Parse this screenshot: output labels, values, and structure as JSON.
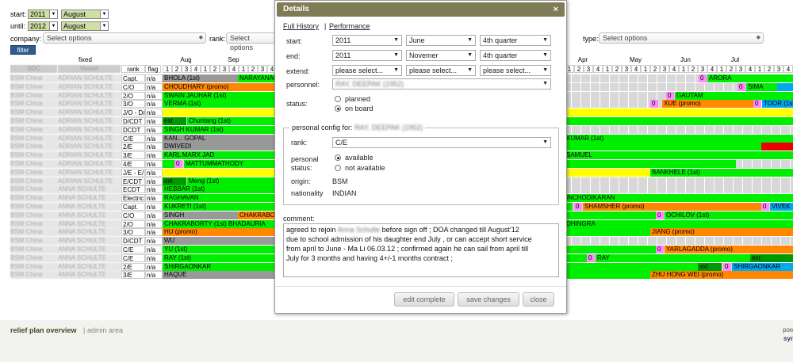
{
  "toolbar": {
    "start_label": "start:",
    "start_year": "2011",
    "start_month": "August",
    "until_label": "until:",
    "until_year": "2012",
    "until_month": "August",
    "company_label": "company:",
    "company_ph": "Select options",
    "rank_label": "rank:",
    "rank_ph": "Select options",
    "type_label": "type:",
    "type_ph": "Select options",
    "filter_label": "filter"
  },
  "grid": {
    "fixed_label": "fixed",
    "rank_header": "rank",
    "flag_header": "flag",
    "col_hdr1": "SDC",
    "col_hdr2": "Vessel",
    "months": [
      "Aug",
      "Sep",
      "Apr",
      "May",
      "Jun",
      "Jul"
    ],
    "weeks": [
      "1",
      "2",
      "3",
      "4"
    ],
    "rows": [
      {
        "c1": "BSM China",
        "c2": "ADRIAN SCHULTE",
        "rank": "Capt.",
        "flag": "n/a",
        "bars": [
          {
            "l": 205,
            "w": 120,
            "t": "BHOLA (1st)",
            "c": "#999"
          },
          {
            "l": 300,
            "w": 46,
            "t": "NARAYANAN",
            "c": "#00ee00"
          },
          {
            "l": 881,
            "w": 10,
            "t": "0",
            "c": "#ff88ff"
          },
          {
            "l": 892,
            "w": 108,
            "t": "ARORA",
            "c": "#00ee00"
          }
        ]
      },
      {
        "c1": "BSM China",
        "c2": "ADRIAN SCHULTE",
        "rank": "C/O",
        "flag": "n/a",
        "bars": [
          {
            "l": 205,
            "w": 141,
            "t": "CHOUDHARY (promo)",
            "c": "#ff8800"
          },
          {
            "l": 930,
            "w": 10,
            "t": "0",
            "c": "#ff88ff"
          },
          {
            "l": 941,
            "w": 40,
            "t": "SIMA",
            "c": "#00ee00"
          },
          {
            "l": 980,
            "w": 20,
            "t": "",
            "c": "#00aaee"
          }
        ]
      },
      {
        "c1": "BSM China",
        "c2": "ADRIAN SCHULTE",
        "rank": "2/O",
        "flag": "n/a",
        "bars": [
          {
            "l": 205,
            "w": 141,
            "t": "SWAIN       JAUHAR (1st)",
            "c": "#00ee00"
          },
          {
            "l": 840,
            "w": 10,
            "t": "0",
            "c": "#ff88ff"
          },
          {
            "l": 851,
            "w": 149,
            "t": "GAUTAM",
            "c": "#00ee00"
          }
        ]
      },
      {
        "c1": "BSM China",
        "c2": "ADRIAN SCHULTE",
        "rank": "3/O",
        "flag": "n/a",
        "bars": [
          {
            "l": 205,
            "w": 141,
            "t": "VERMA (1st)",
            "c": "#00ee00"
          },
          {
            "l": 820,
            "w": 10,
            "t": "0",
            "c": "#ff88ff"
          },
          {
            "l": 835,
            "w": 120,
            "t": "XUE (promo)",
            "c": "#ff8800"
          },
          {
            "l": 950,
            "w": 10,
            "t": "0",
            "c": "#ff88ff"
          },
          {
            "l": 961,
            "w": 39,
            "t": "TOOR (1st)",
            "c": "#00aaee"
          }
        ]
      },
      {
        "c1": "BSM China",
        "c2": "ADRIAN SCHULTE",
        "rank": "J/O - D/",
        "flag": "n/a",
        "bars": [
          {
            "l": 205,
            "w": 141,
            "t": "",
            "c": "#ffff00"
          },
          {
            "l": 712,
            "w": 288,
            "t": "",
            "c": "#ffff00"
          }
        ]
      },
      {
        "c1": "BSM China",
        "c2": "ADRIAN SCHULTE",
        "rank": "D/CDT",
        "flag": "n/a",
        "bars": [
          {
            "l": 205,
            "w": 30,
            "t": "ext",
            "c": "#009900"
          },
          {
            "l": 236,
            "w": 110,
            "t": "Chuntang (1st)",
            "c": "#00ee00"
          },
          {
            "l": 712,
            "w": 288,
            "t": "",
            "c": "#00ee00"
          }
        ]
      },
      {
        "c1": "BSM China",
        "c2": "ADRIAN SCHULTE",
        "rank": "DCDT",
        "flag": "n/a",
        "bars": [
          {
            "l": 205,
            "w": 141,
            "t": "SINGH KUMAR (1st)",
            "c": "#00ee00"
          }
        ]
      },
      {
        "c1": "BSM China",
        "c2": "ADRIAN SCHULTE",
        "rank": "C/E",
        "flag": "n/a",
        "bars": [
          {
            "l": 205,
            "w": 141,
            "t": "KAN...       GOPAL",
            "c": "#999"
          },
          {
            "l": 712,
            "w": 288,
            "t": "                        KUMAR (1st)",
            "c": "#00ee00"
          }
        ]
      },
      {
        "c1": "BSM China",
        "c2": "ADRIAN SCHULTE",
        "rank": "2/E",
        "flag": "n/a",
        "bars": [
          {
            "l": 205,
            "w": 141,
            "t": "DWIVEDI",
            "c": "#999"
          },
          {
            "l": 712,
            "w": 248,
            "t": "",
            "c": "#00ee00"
          },
          {
            "l": 960,
            "w": 40,
            "t": "",
            "c": "#ee0000"
          }
        ]
      },
      {
        "c1": "BSM China",
        "c2": "ADRIAN SCHULTE",
        "rank": "3/E",
        "flag": "n/a",
        "bars": [
          {
            "l": 205,
            "w": 141,
            "t": "KARL MARX                              JAD",
            "c": "#00ee00"
          },
          {
            "l": 712,
            "w": 288,
            "t": "         SAMUEL",
            "c": "#00ee00"
          }
        ]
      },
      {
        "c1": "BSM China",
        "c2": "ADRIAN SCHULTE",
        "rank": "4/E",
        "flag": "n/a",
        "bars": [
          {
            "l": 205,
            "w": 15,
            "t": "",
            "c": "#00ee00"
          },
          {
            "l": 220,
            "w": 10,
            "t": "0",
            "c": "#ff88ff"
          },
          {
            "l": 232,
            "w": 114,
            "t": "MATTUMMATHODY",
            "c": "#00ee00"
          },
          {
            "l": 712,
            "w": 216,
            "t": "",
            "c": "#00ee00"
          }
        ]
      },
      {
        "c1": "BSM China",
        "c2": "ADRIAN SCHULTE",
        "rank": "J/E - E/",
        "flag": "n/a",
        "bars": [
          {
            "l": 205,
            "w": 141,
            "t": "",
            "c": "#ffff00"
          },
          {
            "l": 712,
            "w": 108,
            "t": "",
            "c": "#ffff00"
          },
          {
            "l": 820,
            "w": 180,
            "t": "BANKHELE (1st)",
            "c": "#00ee00"
          }
        ]
      },
      {
        "c1": "BSM China",
        "c2": "ADRIAN SCHULTE",
        "rank": "E/CDT",
        "flag": "n/a",
        "bars": [
          {
            "l": 205,
            "w": 30,
            "t": "ext",
            "c": "#009900"
          },
          {
            "l": 236,
            "w": 110,
            "t": "Meng (1st)",
            "c": "#00ee00"
          }
        ]
      },
      {
        "c1": "BSM China",
        "c2": "ANNA SCHULTE",
        "rank": "ECDT",
        "flag": "n/a",
        "bars": [
          {
            "l": 205,
            "w": 141,
            "t": "HEBBAR (1st)",
            "c": "#00ee00"
          }
        ]
      },
      {
        "c1": "BSM China",
        "c2": "ANNA SCHULTE",
        "rank": "Electric",
        "flag": "n/a",
        "bars": [
          {
            "l": 205,
            "w": 141,
            "t": "RAGHAVAN",
            "c": "#00ee00"
          },
          {
            "l": 712,
            "w": 288,
            "t": "            INCHODIKARAN",
            "c": "#00ee00"
          }
        ]
      },
      {
        "c1": "BSM China",
        "c2": "ANNA SCHULTE",
        "rank": "Capt.",
        "flag": "n/a",
        "bars": [
          {
            "l": 205,
            "w": 141,
            "t": "KUKRETI (1st)",
            "c": "#00ee00"
          },
          {
            "l": 712,
            "w": 10,
            "t": "",
            "c": "#00ee00"
          },
          {
            "l": 724,
            "w": 10,
            "t": "0",
            "c": "#ff88ff"
          },
          {
            "l": 735,
            "w": 225,
            "t": "SHAMSHER (promo)",
            "c": "#ff8800"
          },
          {
            "l": 960,
            "w": 10,
            "t": "0",
            "c": "#ff88ff"
          },
          {
            "l": 971,
            "w": 29,
            "t": "VIVEK",
            "c": "#00aaee"
          }
        ]
      },
      {
        "c1": "BSM China",
        "c2": "ANNA SCHULTE",
        "rank": "C/O",
        "flag": "n/a",
        "bars": [
          {
            "l": 205,
            "w": 95,
            "t": "SINGH",
            "c": "#999"
          },
          {
            "l": 300,
            "w": 46,
            "t": "CHAKRABO",
            "c": "#ff8800"
          },
          {
            "l": 712,
            "w": 115,
            "t": "",
            "c": "#00ee00"
          },
          {
            "l": 827,
            "w": 10,
            "t": "0",
            "c": "#ff88ff"
          },
          {
            "l": 838,
            "w": 162,
            "t": "OCHILOV (1st)",
            "c": "#00ee00"
          }
        ]
      },
      {
        "c1": "BSM China",
        "c2": "ANNA SCHULTE",
        "rank": "2/O",
        "flag": "n/a",
        "bars": [
          {
            "l": 205,
            "w": 141,
            "t": "CHAKRABORTY (1st)     BHADAURIA",
            "c": "#00ee00"
          },
          {
            "l": 712,
            "w": 288,
            "t": "DHINGRA",
            "c": "#00ee00"
          }
        ]
      },
      {
        "c1": "BSM China",
        "c2": "ANNA SCHULTE",
        "rank": "3/O",
        "flag": "n/a",
        "bars": [
          {
            "l": 205,
            "w": 141,
            "t": "HU (promo)",
            "c": "#ff8800"
          },
          {
            "l": 712,
            "w": 108,
            "t": "",
            "c": "#00ee00"
          },
          {
            "l": 820,
            "w": 180,
            "t": "JIANG (promo)",
            "c": "#ff8800"
          }
        ]
      },
      {
        "c1": "BSM China",
        "c2": "ANNA SCHULTE",
        "rank": "D/CDT",
        "flag": "n/a",
        "bars": [
          {
            "l": 205,
            "w": 141,
            "t": "WU",
            "c": "#999"
          }
        ]
      },
      {
        "c1": "BSM China",
        "c2": "ANNA SCHULTE",
        "rank": "C/E",
        "flag": "n/a",
        "bars": [
          {
            "l": 205,
            "w": 141,
            "t": "YU (1st)",
            "c": "#00ee00"
          },
          {
            "l": 712,
            "w": 115,
            "t": "",
            "c": "#00ee00"
          },
          {
            "l": 827,
            "w": 10,
            "t": "0",
            "c": "#ff88ff"
          },
          {
            "l": 838,
            "w": 162,
            "t": "YARLAGADDA (promo)",
            "c": "#ff8800"
          }
        ]
      },
      {
        "c1": "BSM China",
        "c2": "ANNA SCHULTE",
        "rank": "C/E",
        "flag": "n/a",
        "bars": [
          {
            "l": 205,
            "w": 141,
            "t": "RAY (1st)",
            "c": "#00ee00"
          },
          {
            "l": 712,
            "w": 28,
            "t": "",
            "c": "#00ee00"
          },
          {
            "l": 740,
            "w": 10,
            "t": "0",
            "c": "#ff88ff"
          },
          {
            "l": 751,
            "w": 195,
            "t": "RAY",
            "c": "#00ee00"
          },
          {
            "l": 946,
            "w": 54,
            "t": "ext",
            "c": "#009900"
          }
        ]
      },
      {
        "c1": "BSM China",
        "c2": "ANNA SCHULTE",
        "rank": "2/E",
        "flag": "n/a",
        "bars": [
          {
            "l": 205,
            "w": 141,
            "t": "SHIRGAONKAR",
            "c": "#00ee00"
          },
          {
            "l": 712,
            "w": 168,
            "t": "",
            "c": "#00ee00"
          },
          {
            "l": 880,
            "w": 30,
            "t": "ext",
            "c": "#009900"
          },
          {
            "l": 912,
            "w": 10,
            "t": "0",
            "c": "#ff88ff"
          },
          {
            "l": 923,
            "w": 77,
            "t": "SHIRGAONKAR",
            "c": "#00aaee"
          }
        ]
      },
      {
        "c1": "BSM China",
        "c2": "ANNA SCHULTE",
        "rank": "3/E",
        "flag": "n/a",
        "bars": [
          {
            "l": 205,
            "w": 141,
            "t": "HAQUE",
            "c": "#999"
          },
          {
            "l": 712,
            "w": 108,
            "t": "",
            "c": "#00ee00"
          },
          {
            "l": 820,
            "w": 180,
            "t": "ZHU HONG WEI (promo)",
            "c": "#ff8800"
          }
        ]
      }
    ]
  },
  "modal": {
    "title": "Details",
    "close": "×",
    "link_history": "Full History",
    "link_sep": "|",
    "link_perf": "Performance",
    "start_label": "start:",
    "start_year": "2011",
    "start_month": "June",
    "start_quarter": "4th quarter",
    "end_label": "end:",
    "end_year": "2011",
    "end_month": "Novemer",
    "end_quarter": "4th quarter",
    "extend_label": "extend:",
    "extend_ph": "please select...",
    "personnel_label": "personnel:",
    "personnel_value": "RAY, DEEPAK (1952)",
    "status_label": "status:",
    "status_opt1": "planned",
    "status_opt2": "on board",
    "config_legend": "personal config for:",
    "config_name": "RAY, DEEPAK (1952)",
    "rank_label": "rank:",
    "rank_value": "C/E",
    "pstatus_label1": "personal",
    "pstatus_label2": "status:",
    "pstatus_opt1": "available",
    "pstatus_opt2": "not available",
    "origin_label": "origin:",
    "origin_value": "BSM",
    "nationality_label": "nationality",
    "nationality_value": "INDIAN",
    "comment_label": "comment:",
    "comment_l1a": "agreed to rejoin",
    "comment_l1blur": "Anna Schulte",
    "comment_l1b": "before sign off ; DOA changed till August'12",
    "comment_l2": "due to school admission of his daughter end July , or can accept short service",
    "comment_l3": "from april to June - Ma Li 06.03.12 ; confirmed again he can sail from april till",
    "comment_l4": "July for 3 months and having 4+/-1 months contract ;",
    "btn_edit": "edit complete",
    "btn_save": "save changes",
    "btn_close": "close"
  },
  "footer": {
    "link1": "relief plan overview",
    "sep": "|",
    "link2": "admin area",
    "powered": "pow",
    "brand": "syn"
  }
}
